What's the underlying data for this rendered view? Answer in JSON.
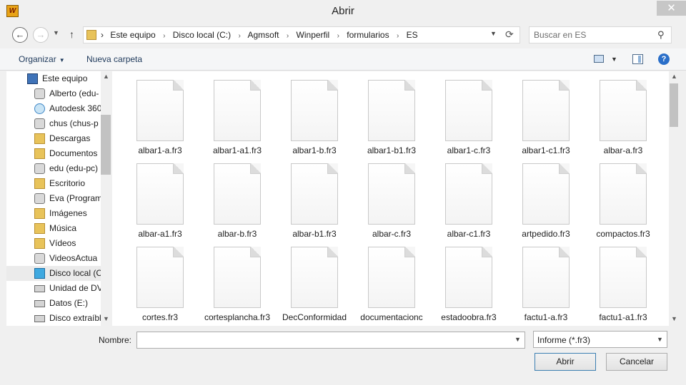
{
  "window": {
    "title": "Abrir",
    "app_icon_text": "W",
    "close_glyph": "✕"
  },
  "address": {
    "crumbs": [
      "Este equipo",
      "Disco local (C:)",
      "Agmsoft",
      "Winperfil",
      "formularios",
      "ES"
    ],
    "separator": "›"
  },
  "search": {
    "placeholder": "Buscar en ES"
  },
  "toolbar": {
    "organize_label": "Organizar",
    "new_folder_label": "Nueva carpeta",
    "help_glyph": "?"
  },
  "sidebar": {
    "items": [
      {
        "label": "Este equipo",
        "icon": "computer-icon"
      },
      {
        "label": "Alberto (edu-",
        "icon": "network-user-icon"
      },
      {
        "label": "Autodesk 360",
        "icon": "cloud-icon"
      },
      {
        "label": "chus (chus-p",
        "icon": "network-user-icon"
      },
      {
        "label": "Descargas",
        "icon": "downloads-folder-icon"
      },
      {
        "label": "Documentos",
        "icon": "documents-folder-icon"
      },
      {
        "label": "edu (edu-pc)",
        "icon": "network-user-icon"
      },
      {
        "label": "Escritorio",
        "icon": "desktop-folder-icon"
      },
      {
        "label": "Eva (Program",
        "icon": "network-user-icon"
      },
      {
        "label": "Imágenes",
        "icon": "pictures-folder-icon"
      },
      {
        "label": "Música",
        "icon": "music-folder-icon"
      },
      {
        "label": "Vídeos",
        "icon": "videos-folder-icon"
      },
      {
        "label": "VideosActua",
        "icon": "network-user-icon"
      },
      {
        "label": "Disco local (C",
        "icon": "windows-drive-icon"
      },
      {
        "label": "Unidad de DV",
        "icon": "dvd-drive-icon"
      },
      {
        "label": "Datos (E:)",
        "icon": "drive-icon"
      },
      {
        "label": "Disco extraíbl",
        "icon": "removable-drive-icon"
      }
    ]
  },
  "files": [
    "albar1-a.fr3",
    "albar1-a1.fr3",
    "albar1-b.fr3",
    "albar1-b1.fr3",
    "albar1-c.fr3",
    "albar1-c1.fr3",
    "albar-a.fr3",
    "albar-a1.fr3",
    "albar-b.fr3",
    "albar-b1.fr3",
    "albar-c.fr3",
    "albar-c1.fr3",
    "artpedido.fr3",
    "compactos.fr3",
    "cortes.fr3",
    "cortesplancha.fr3",
    "DecConformidad",
    "documentacionc",
    "estadoobra.fr3",
    "factu1-a.fr3",
    "factu1-a1.fr3"
  ],
  "bottom": {
    "name_label": "Nombre:",
    "name_value": "",
    "filetype": "Informe (*.fr3)",
    "open_label": "Abrir",
    "cancel_label": "Cancelar"
  }
}
